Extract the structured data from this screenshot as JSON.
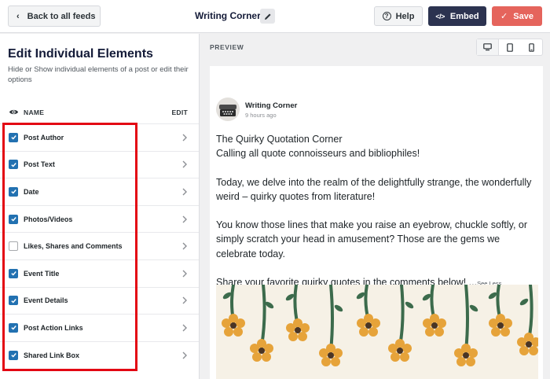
{
  "topbar": {
    "back_label": "Back to all feeds",
    "feed_title": "Writing Corner",
    "help_label": "Help",
    "embed_label": "Embed",
    "save_label": "Save"
  },
  "sidebar": {
    "title": "Edit Individual Elements",
    "description": "Hide or Show individual elements of a post or edit their options",
    "col_name": "NAME",
    "col_edit": "EDIT",
    "items": [
      {
        "label": "Post Author",
        "checked": true
      },
      {
        "label": "Post Text",
        "checked": true
      },
      {
        "label": "Date",
        "checked": true
      },
      {
        "label": "Photos/Videos",
        "checked": true
      },
      {
        "label": "Likes, Shares and Comments",
        "checked": false
      },
      {
        "label": "Event Title",
        "checked": true
      },
      {
        "label": "Event Details",
        "checked": true
      },
      {
        "label": "Post Action Links",
        "checked": true
      },
      {
        "label": "Shared Link Box",
        "checked": true
      }
    ]
  },
  "preview": {
    "label": "PREVIEW",
    "active_device": "desktop",
    "post": {
      "author": "Writing Corner",
      "time": "9 hours ago",
      "line1": "The Quirky Quotation Corner",
      "line2": "Calling all quote connoisseurs and bibliophiles!",
      "para2": "Today, we delve into the realm of the delightfully strange, the wonderfully weird – quirky quotes from literature!",
      "para3": "You know those lines that make you raise an eyebrow, chuckle softly, or simply scratch your head in amusement? Those are the gems we celebrate today.",
      "para4": "Share your favorite quirky quotes in the comments below! ...",
      "see_less": "See Less"
    }
  },
  "colors": {
    "accent_blue": "#2271b1",
    "embed_dark": "#2c3350",
    "save_red": "#e5645c",
    "highlight_red": "#e30613"
  }
}
